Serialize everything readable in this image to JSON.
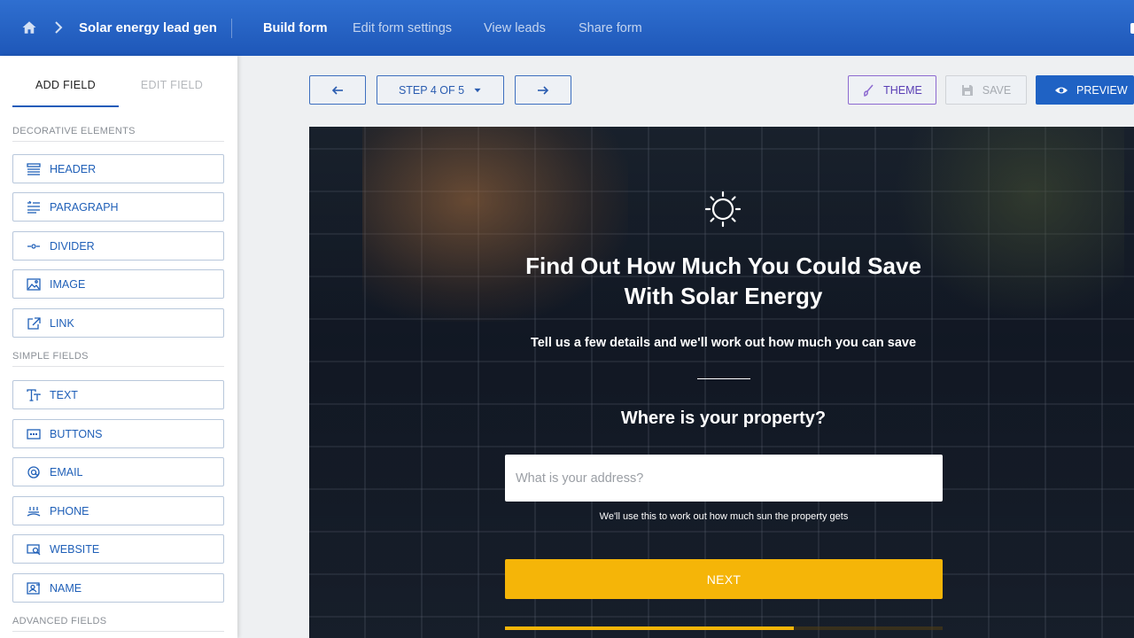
{
  "header": {
    "form_name": "Solar energy lead gen",
    "tabs": [
      {
        "label": "Build form",
        "active": true
      },
      {
        "label": "Edit form settings",
        "active": false
      },
      {
        "label": "View leads",
        "active": false
      },
      {
        "label": "Share form",
        "active": false
      }
    ],
    "icons": {
      "home": "home-icon",
      "breadcrumb": "chevron-right-icon"
    }
  },
  "sidebar": {
    "tabs": [
      {
        "label": "ADD FIELD",
        "active": true
      },
      {
        "label": "EDIT FIELD",
        "active": false
      }
    ],
    "sections": [
      {
        "label": "DECORATIVE ELEMENTS",
        "items": [
          {
            "label": "HEADER",
            "icon": "header-icon"
          },
          {
            "label": "PARAGRAPH",
            "icon": "paragraph-icon"
          },
          {
            "label": "DIVIDER",
            "icon": "divider-icon"
          },
          {
            "label": "IMAGE",
            "icon": "image-icon"
          },
          {
            "label": "LINK",
            "icon": "link-icon"
          }
        ]
      },
      {
        "label": "SIMPLE FIELDS",
        "items": [
          {
            "label": "TEXT",
            "icon": "text-icon"
          },
          {
            "label": "BUTTONS",
            "icon": "buttons-icon"
          },
          {
            "label": "EMAIL",
            "icon": "email-icon"
          },
          {
            "label": "PHONE",
            "icon": "phone-icon"
          },
          {
            "label": "WEBSITE",
            "icon": "website-icon"
          },
          {
            "label": "NAME",
            "icon": "name-icon"
          }
        ]
      },
      {
        "label": "ADVANCED FIELDS",
        "items": []
      }
    ]
  },
  "toolbar": {
    "step_label": "STEP 4 OF 5",
    "theme_label": "THEME",
    "save_label": "SAVE",
    "preview_label": "PREVIEW"
  },
  "form": {
    "title_line1": "Find Out How Much You Could Save",
    "title_line2": "With Solar Energy",
    "subtitle": "Tell us a few details and we'll work out how much you can save",
    "question": "Where is your property?",
    "address_placeholder": "What is your address?",
    "helper_text": "We'll use this to work out how much sun the property gets",
    "next_label": "NEXT",
    "progress": 0.66
  },
  "colors": {
    "header_bg": "#2f6fd0",
    "accent": "#1f62c4",
    "next_button": "#f5b508",
    "theme_accent": "#8d6ad0"
  }
}
